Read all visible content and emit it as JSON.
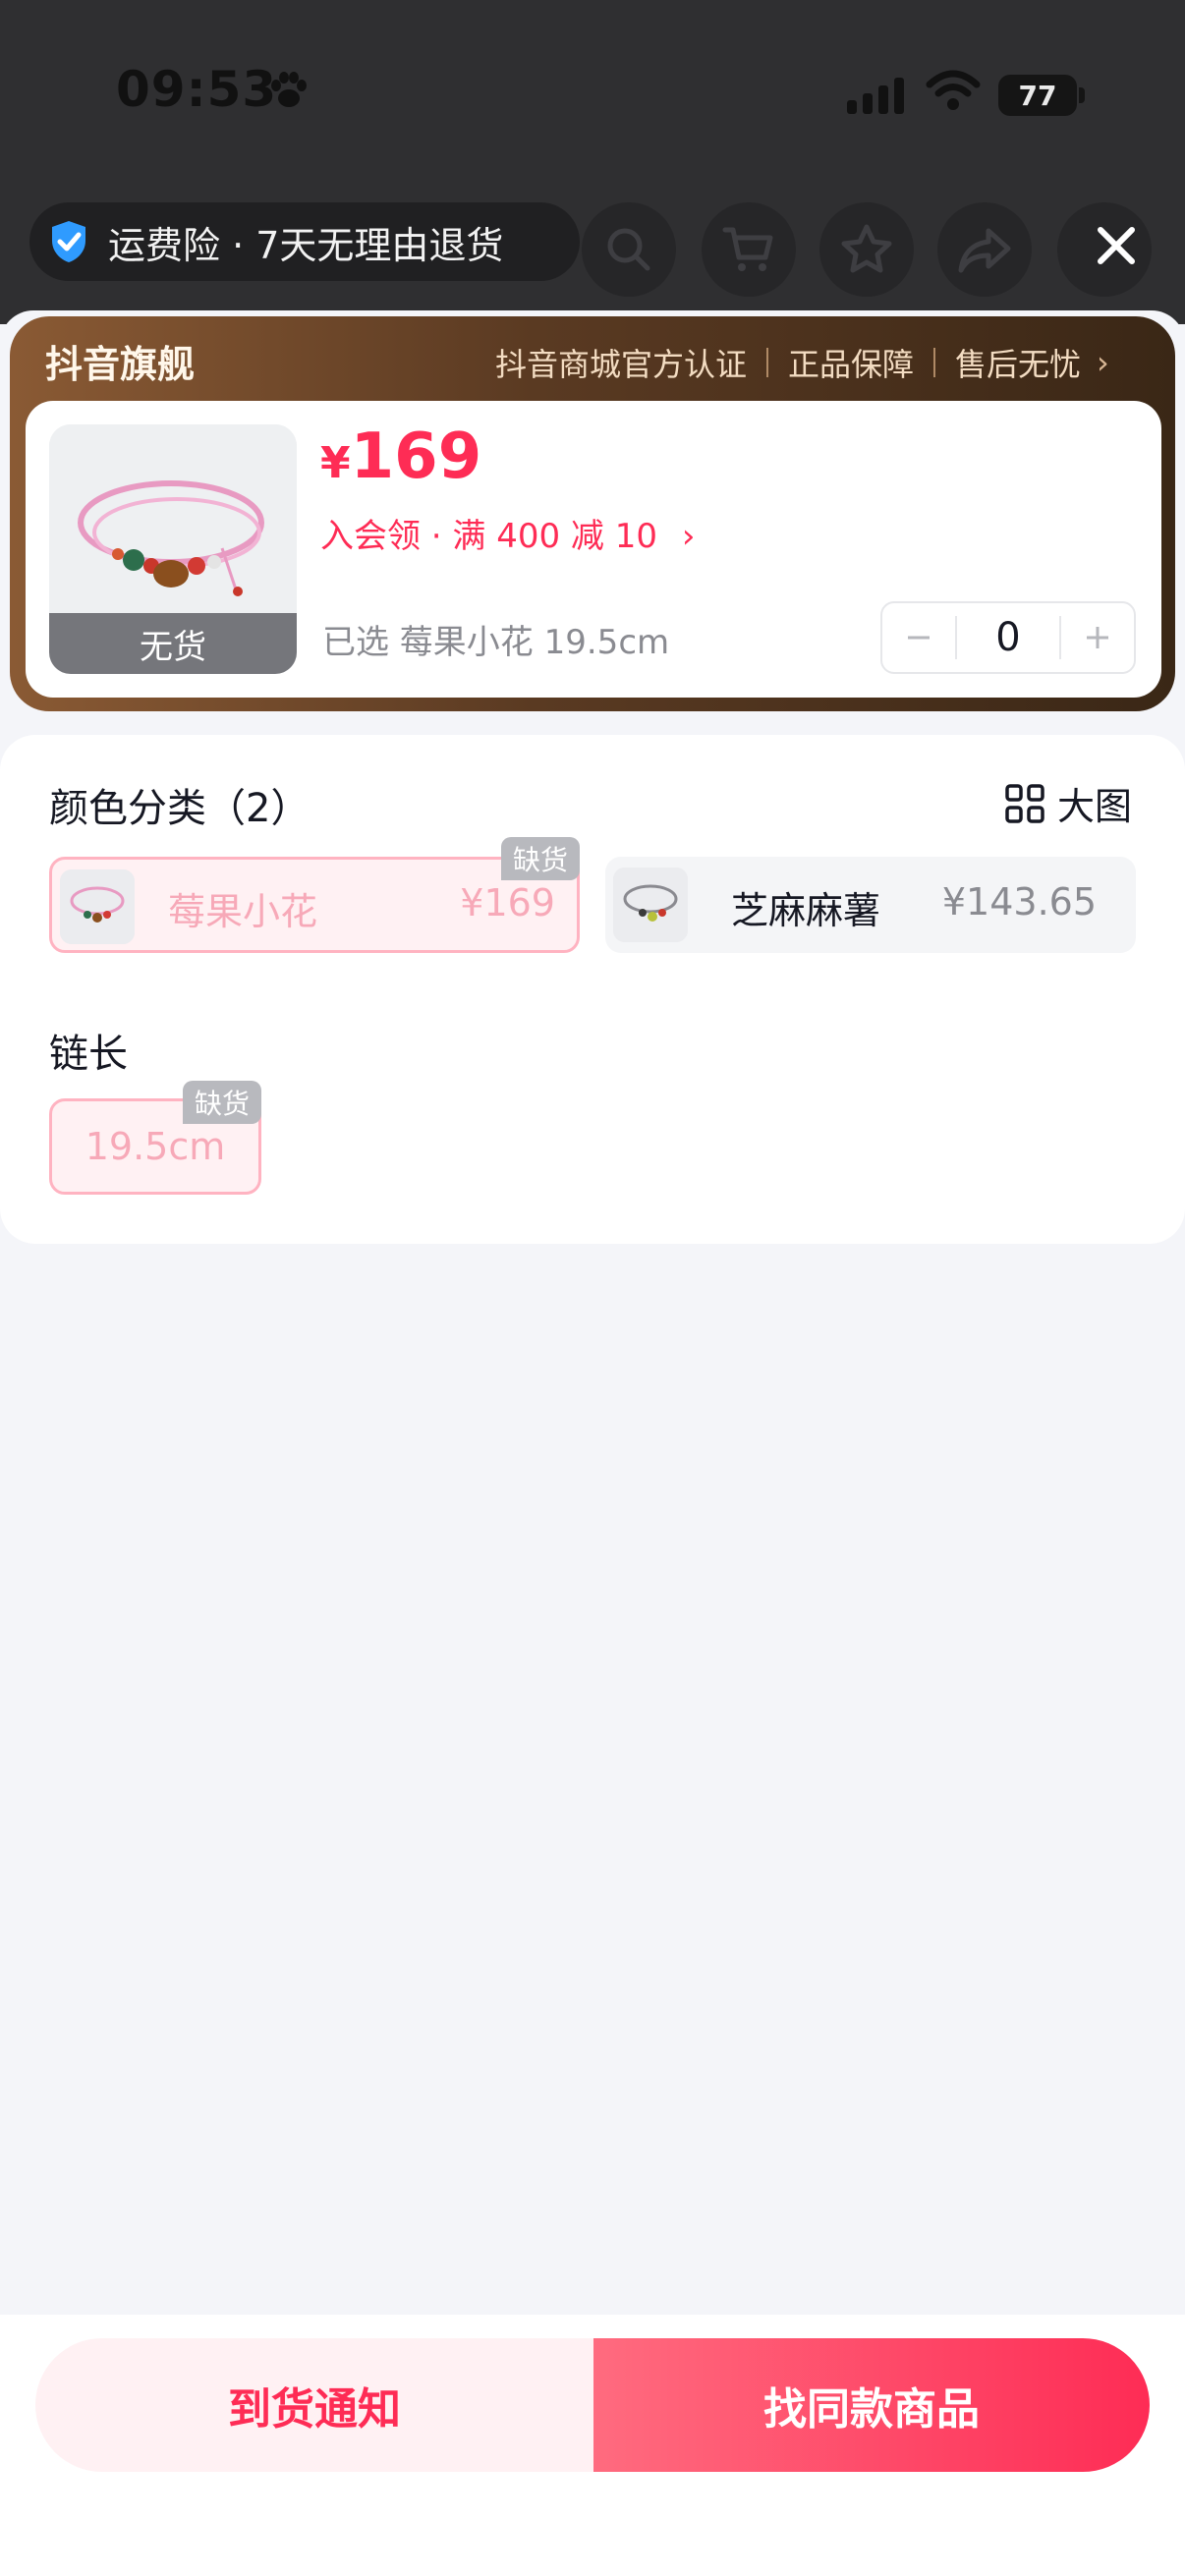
{
  "status_bar": {
    "time": "09:53",
    "battery": "77"
  },
  "top": {
    "insurance_text": "运费险 · 7天无理由退货",
    "icons": [
      "search-icon",
      "cart-icon",
      "star-icon",
      "share-icon",
      "close-icon"
    ]
  },
  "brand": {
    "title": "抖音旗舰",
    "tags": [
      "抖音商城官方认证",
      "正品保障",
      "售后无忧"
    ]
  },
  "product": {
    "status": "无货",
    "currency": "¥",
    "price": "169",
    "promo": "入会领 · 满 400 减 10",
    "selected": "已选 莓果小花 19.5cm",
    "quantity": "0"
  },
  "color_section": {
    "title": "颜色分类（2）",
    "big_view_label": "大图",
    "options": [
      {
        "name": "莓果小花",
        "price": "¥169",
        "tag": "缺货"
      },
      {
        "name": "芝麻麻薯",
        "price": "¥143.65"
      }
    ]
  },
  "length_section": {
    "title": "链长",
    "options": [
      {
        "name": "19.5cm",
        "tag": "缺货"
      }
    ]
  },
  "actions": {
    "notify": "到货通知",
    "find_same": "找同款商品"
  },
  "colors": {
    "accent": "#fe2c55",
    "brand_bar": "#5a3a22"
  }
}
